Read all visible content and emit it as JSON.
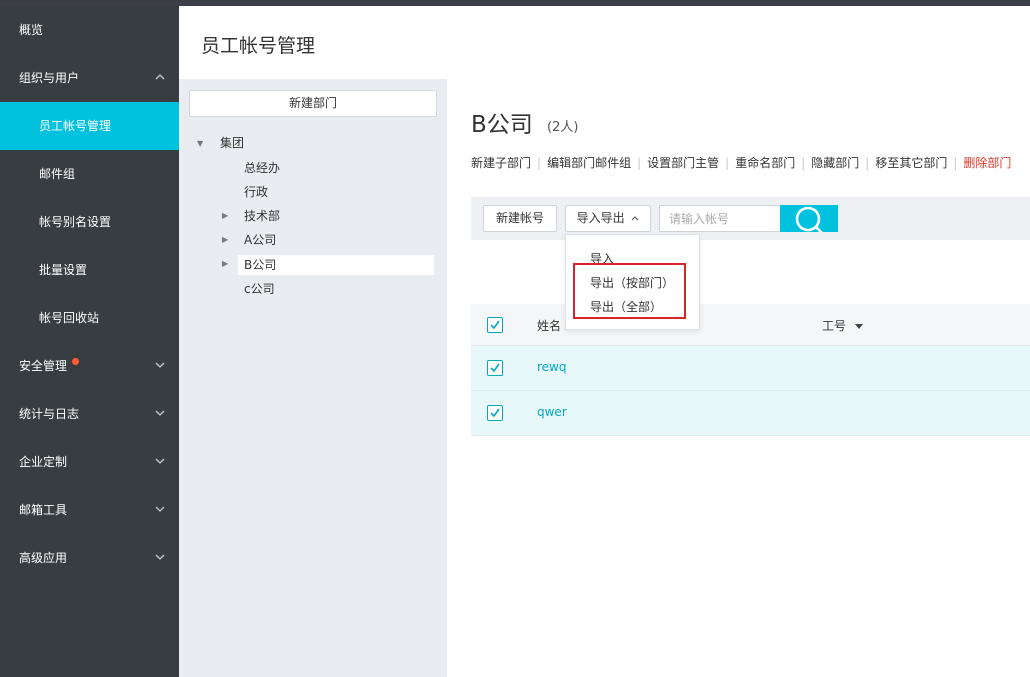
{
  "sidebar": {
    "items": [
      {
        "label": "概览",
        "sub": false
      },
      {
        "label": "组织与用户",
        "sub": false,
        "chevron": "up"
      },
      {
        "label": "员工帐号管理",
        "sub": true,
        "active": true
      },
      {
        "label": "邮件组",
        "sub": true
      },
      {
        "label": "帐号别名设置",
        "sub": true
      },
      {
        "label": "批量设置",
        "sub": true
      },
      {
        "label": "帐号回收站",
        "sub": true
      },
      {
        "label": "安全管理",
        "sub": false,
        "chevron": "down",
        "dot": true
      },
      {
        "label": "统计与日志",
        "sub": false,
        "chevron": "down"
      },
      {
        "label": "企业定制",
        "sub": false,
        "chevron": "down"
      },
      {
        "label": "邮箱工具",
        "sub": false,
        "chevron": "down"
      },
      {
        "label": "高级应用",
        "sub": false,
        "chevron": "down"
      }
    ]
  },
  "header": {
    "title": "员工帐号管理"
  },
  "tree": {
    "new_dept_label": "新建部门",
    "nodes": [
      {
        "label": "集团",
        "arrow": "expanded"
      },
      {
        "label": "总经办"
      },
      {
        "label": "行政"
      },
      {
        "label": "技术部",
        "arrow": "collapsed"
      },
      {
        "label": "A公司",
        "arrow": "collapsed"
      },
      {
        "label": "B公司",
        "arrow": "collapsed",
        "selected": true
      },
      {
        "label": "c公司"
      }
    ]
  },
  "main": {
    "company": "B公司",
    "count": "(2人)",
    "actions": [
      "新建子部门",
      "编辑部门邮件组",
      "设置部门主管",
      "重命名部门",
      "隐藏部门",
      "移至其它部门",
      "删除部门"
    ],
    "toolbar": {
      "new_account": "新建帐号",
      "import_export": "导入导出",
      "search_placeholder": "请输入帐号"
    },
    "dropdown": {
      "import": "导入",
      "export_by_dept": "导出（按部门）",
      "export_all": "导出（全部）"
    },
    "table": {
      "col_name": "姓名",
      "col_id": "工号",
      "rows": [
        {
          "name": "rewq"
        },
        {
          "name": "qwer"
        }
      ]
    }
  },
  "colors": {
    "sidebar_bg": "#373d41",
    "accent": "#00c1de",
    "danger": "#e0392b",
    "highlight_box": "#d9232d"
  },
  "icons": {
    "chevron_up": "chevron-up-icon",
    "chevron_down": "chevron-down-icon",
    "tree_expanded": "caret-down-icon",
    "tree_collapsed": "caret-right-icon",
    "search": "search-icon",
    "checkbox": "checkbox-checked-icon"
  }
}
